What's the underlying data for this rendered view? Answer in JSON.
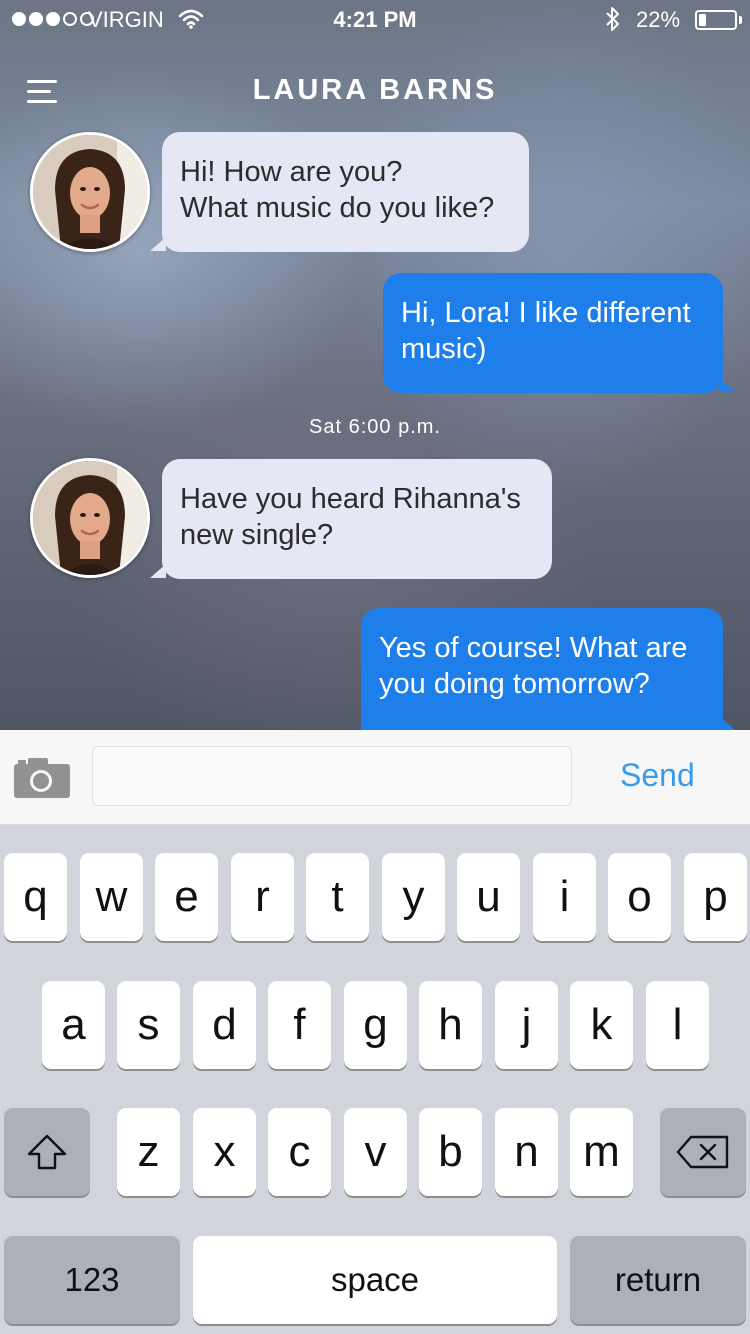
{
  "status_bar": {
    "carrier": "VIRGIN",
    "time": "4:21 PM",
    "battery_percent": "22%",
    "battery_level": 0.22,
    "signal_bars_filled": 3,
    "signal_bars_total": 5
  },
  "header": {
    "title": "LAURA BARNS",
    "menu_icon": "hamburger-menu-icon"
  },
  "messages": [
    {
      "from": "contact",
      "lines": [
        "Hi! How are you?",
        "What music do you like?"
      ]
    },
    {
      "from": "me",
      "lines": [
        "Hi, Lora! I like different",
        "music)"
      ]
    },
    {
      "from": "contact",
      "lines": [
        "Have you heard Rihanna's",
        "new single?"
      ]
    },
    {
      "from": "me",
      "lines": [
        "Yes of course! What are",
        "you doing tomorrow?"
      ]
    }
  ],
  "timestamp": "Sat 6:00 p.m.",
  "input_bar": {
    "camera_icon": "camera-icon",
    "message_value": "",
    "message_placeholder": "",
    "send_label": "Send"
  },
  "keyboard": {
    "row1": [
      "q",
      "w",
      "e",
      "r",
      "t",
      "y",
      "u",
      "i",
      "o",
      "p"
    ],
    "row2": [
      "a",
      "s",
      "d",
      "f",
      "g",
      "h",
      "j",
      "k",
      "l"
    ],
    "row3": [
      "z",
      "x",
      "c",
      "v",
      "b",
      "n",
      "m"
    ],
    "shift_icon": "shift-arrow-icon",
    "delete_icon": "backspace-icon",
    "numbers_label": "123",
    "space_label": "space",
    "return_label": "return"
  },
  "colors": {
    "outgoing_bubble": "#1e7fea",
    "incoming_bubble": "#e6e7f5",
    "send_text": "#3a9be8"
  }
}
